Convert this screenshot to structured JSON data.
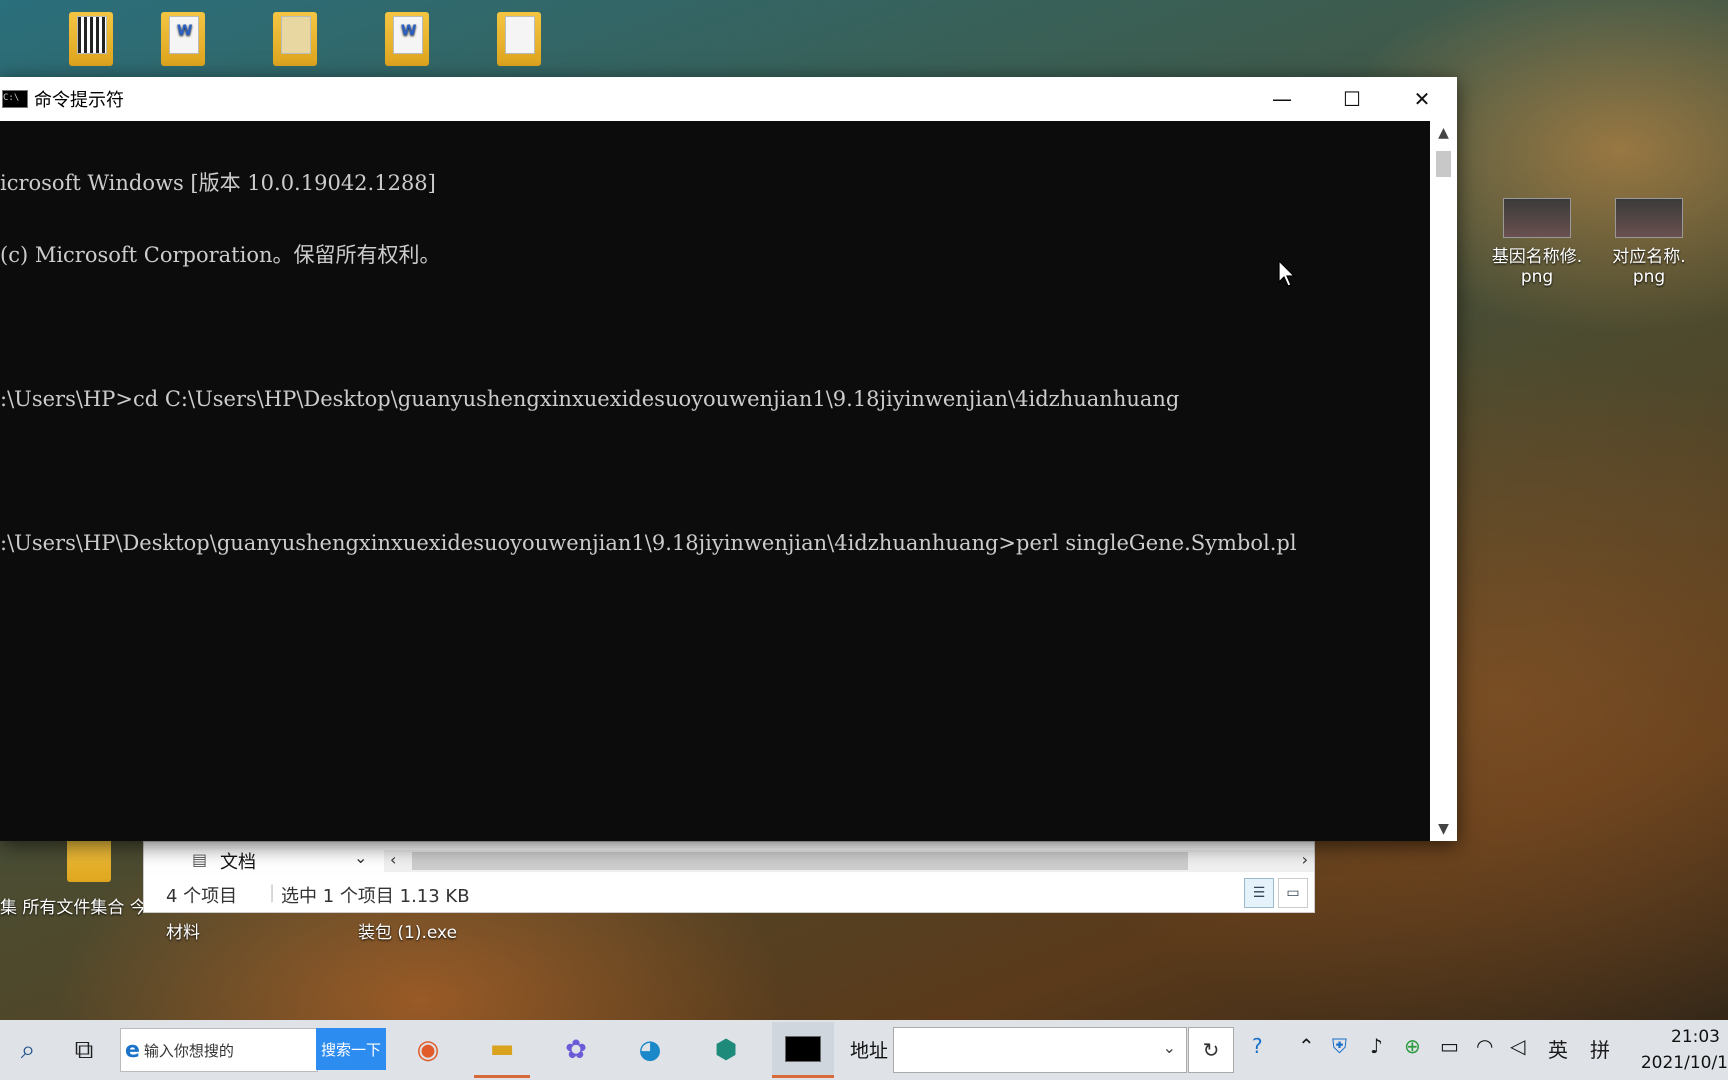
{
  "desktop": {
    "icons_right": [
      {
        "label_line1": "基因名称修.",
        "label_line2": "png"
      },
      {
        "label_line1": "对应名称.",
        "label_line2": "png"
      }
    ],
    "icons_bottom": [
      {
        "label": "集 所有文件集合 今"
      },
      {
        "label": "材料"
      },
      {
        "label": "装包 (1).exe"
      }
    ]
  },
  "cmd_window": {
    "title": "命令提示符",
    "app_icon_text": "C:\\",
    "controls": {
      "minimize": "—",
      "maximize": "☐",
      "close": "✕"
    },
    "lines": [
      "icrosoft Windows [版本 10.0.19042.1288]",
      "(c) Microsoft Corporation。保留所有权利。",
      "",
      ":\\Users\\HP>cd C:\\Users\\HP\\Desktop\\guanyushengxinxuexidesuoyouwenjian1\\9.18jiyinwenjian\\4idzhuanhuang",
      "",
      ":\\Users\\HP\\Desktop\\guanyushengxinxuexidesuoyouwenjian1\\9.18jiyinwenjian\\4idzhuanhuang>perl singleGene.Symbol.pl"
    ]
  },
  "explorer": {
    "nav_item": "文档",
    "item_count": "4 个项目",
    "selection": "选中 1 个项目  1.13 KB"
  },
  "taskbar": {
    "search_placeholder": "输入你想搜的",
    "search_button": "搜索一下",
    "address_label": "地址",
    "address_value": "",
    "ime_lang": "英",
    "ime_mode": "拼",
    "time": "21:03",
    "date": "2021/10/1"
  }
}
